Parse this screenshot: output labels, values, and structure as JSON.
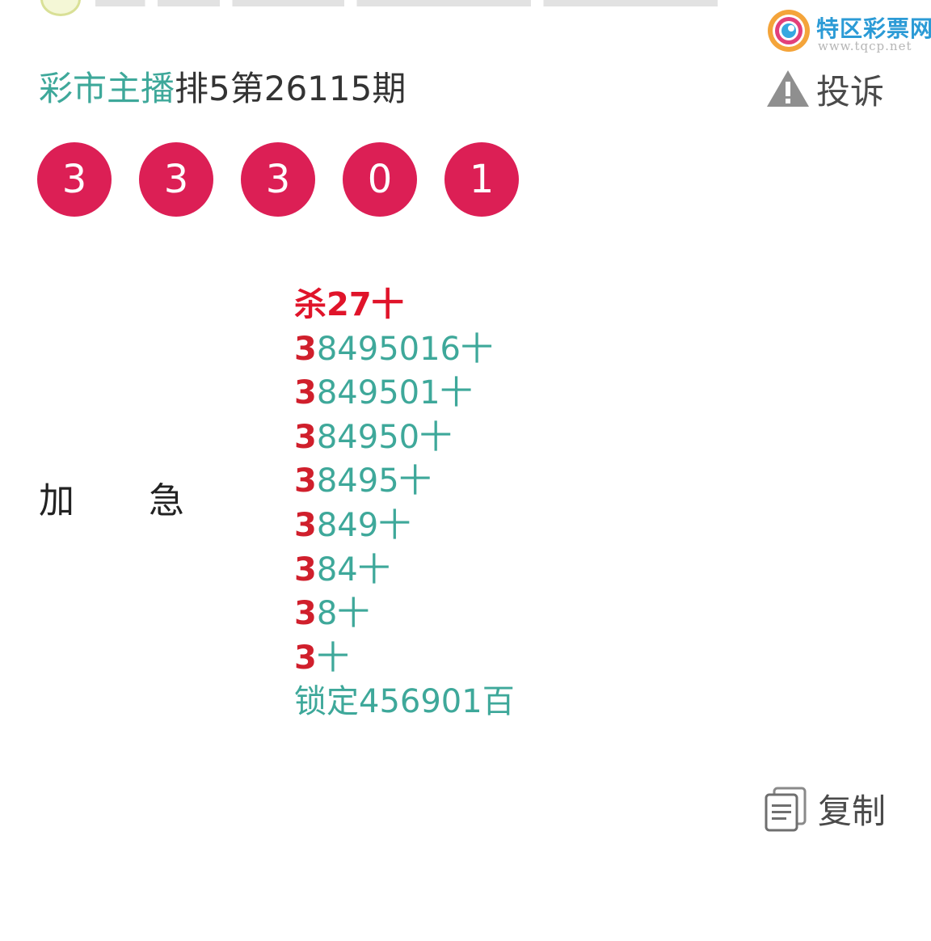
{
  "watermark": {
    "name": "特区彩票网",
    "url": "www.tqcp.net"
  },
  "post": {
    "author": "彩市主播",
    "issue": "排5第26115期"
  },
  "complain_label": "投诉",
  "balls": [
    "3",
    "3",
    "3",
    "0",
    "1"
  ],
  "side_labels": {
    "first": "加",
    "second": "急"
  },
  "lines": [
    {
      "lead": "杀",
      "rest": "27十",
      "kind": "kill"
    },
    {
      "lead": "3",
      "rest": "8495016十"
    },
    {
      "lead": "3",
      "rest": "849501十"
    },
    {
      "lead": "3",
      "rest": "84950十"
    },
    {
      "lead": "3",
      "rest": "8495十"
    },
    {
      "lead": "3",
      "rest": "849十"
    },
    {
      "lead": "3",
      "rest": "84十"
    },
    {
      "lead": "3",
      "rest": "8十"
    },
    {
      "lead": "3",
      "rest": "十"
    },
    {
      "lead": "锁定",
      "rest": "456901百",
      "kind": "lock"
    }
  ],
  "copy_label": "复制",
  "colors": {
    "ball": "#dc1f55",
    "accent": "#3ea89a",
    "red": "#d01f2c",
    "brand_blue": "#2c9bd6"
  }
}
